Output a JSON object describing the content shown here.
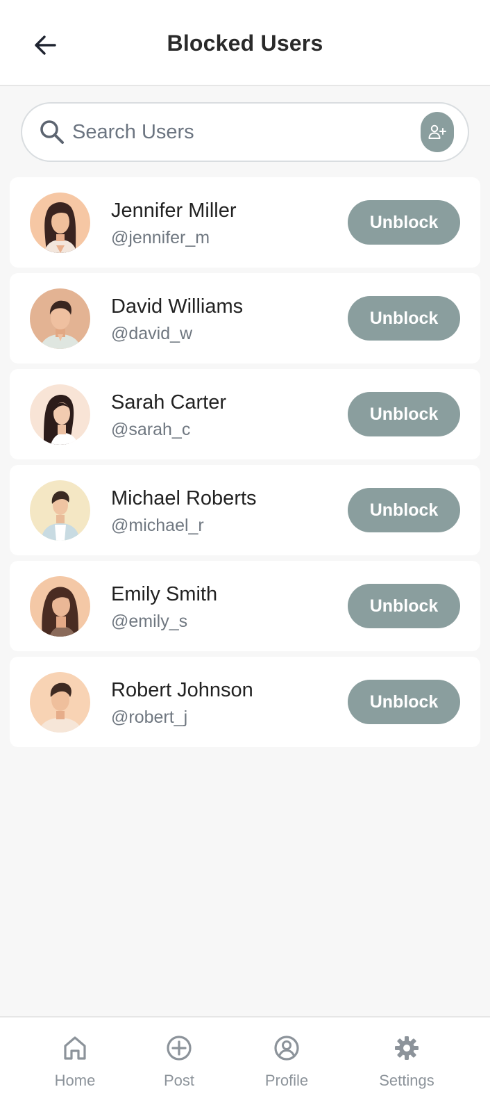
{
  "header": {
    "title": "Blocked Users",
    "back_icon": "arrow-left-icon"
  },
  "search": {
    "placeholder": "Search Users",
    "value": "",
    "search_icon": "magnifier-icon",
    "add_user_icon": "person-add-icon"
  },
  "users": [
    {
      "name": "Jennifer Miller",
      "handle": "@jennifer_m",
      "action": "Unblock"
    },
    {
      "name": "David Williams",
      "handle": "@david_w",
      "action": "Unblock"
    },
    {
      "name": "Sarah Carter",
      "handle": "@sarah_c",
      "action": "Unblock"
    },
    {
      "name": "Michael Roberts",
      "handle": "@michael_r",
      "action": "Unblock"
    },
    {
      "name": "Emily Smith",
      "handle": "@emily_s",
      "action": "Unblock"
    },
    {
      "name": "Robert Johnson",
      "handle": "@robert_j",
      "action": "Unblock"
    }
  ],
  "nav": {
    "items": [
      {
        "label": "Home",
        "icon": "home-icon"
      },
      {
        "label": "Post",
        "icon": "plus-circle-icon"
      },
      {
        "label": "Profile",
        "icon": "user-circle-icon"
      },
      {
        "label": "Settings",
        "icon": "gear-icon"
      }
    ]
  },
  "colors": {
    "accent": "#8a9e9e",
    "background": "#f7f7f7",
    "card": "#ffffff",
    "text_primary": "#222222",
    "text_secondary": "#6f7780",
    "nav_inactive": "#8c939a"
  }
}
